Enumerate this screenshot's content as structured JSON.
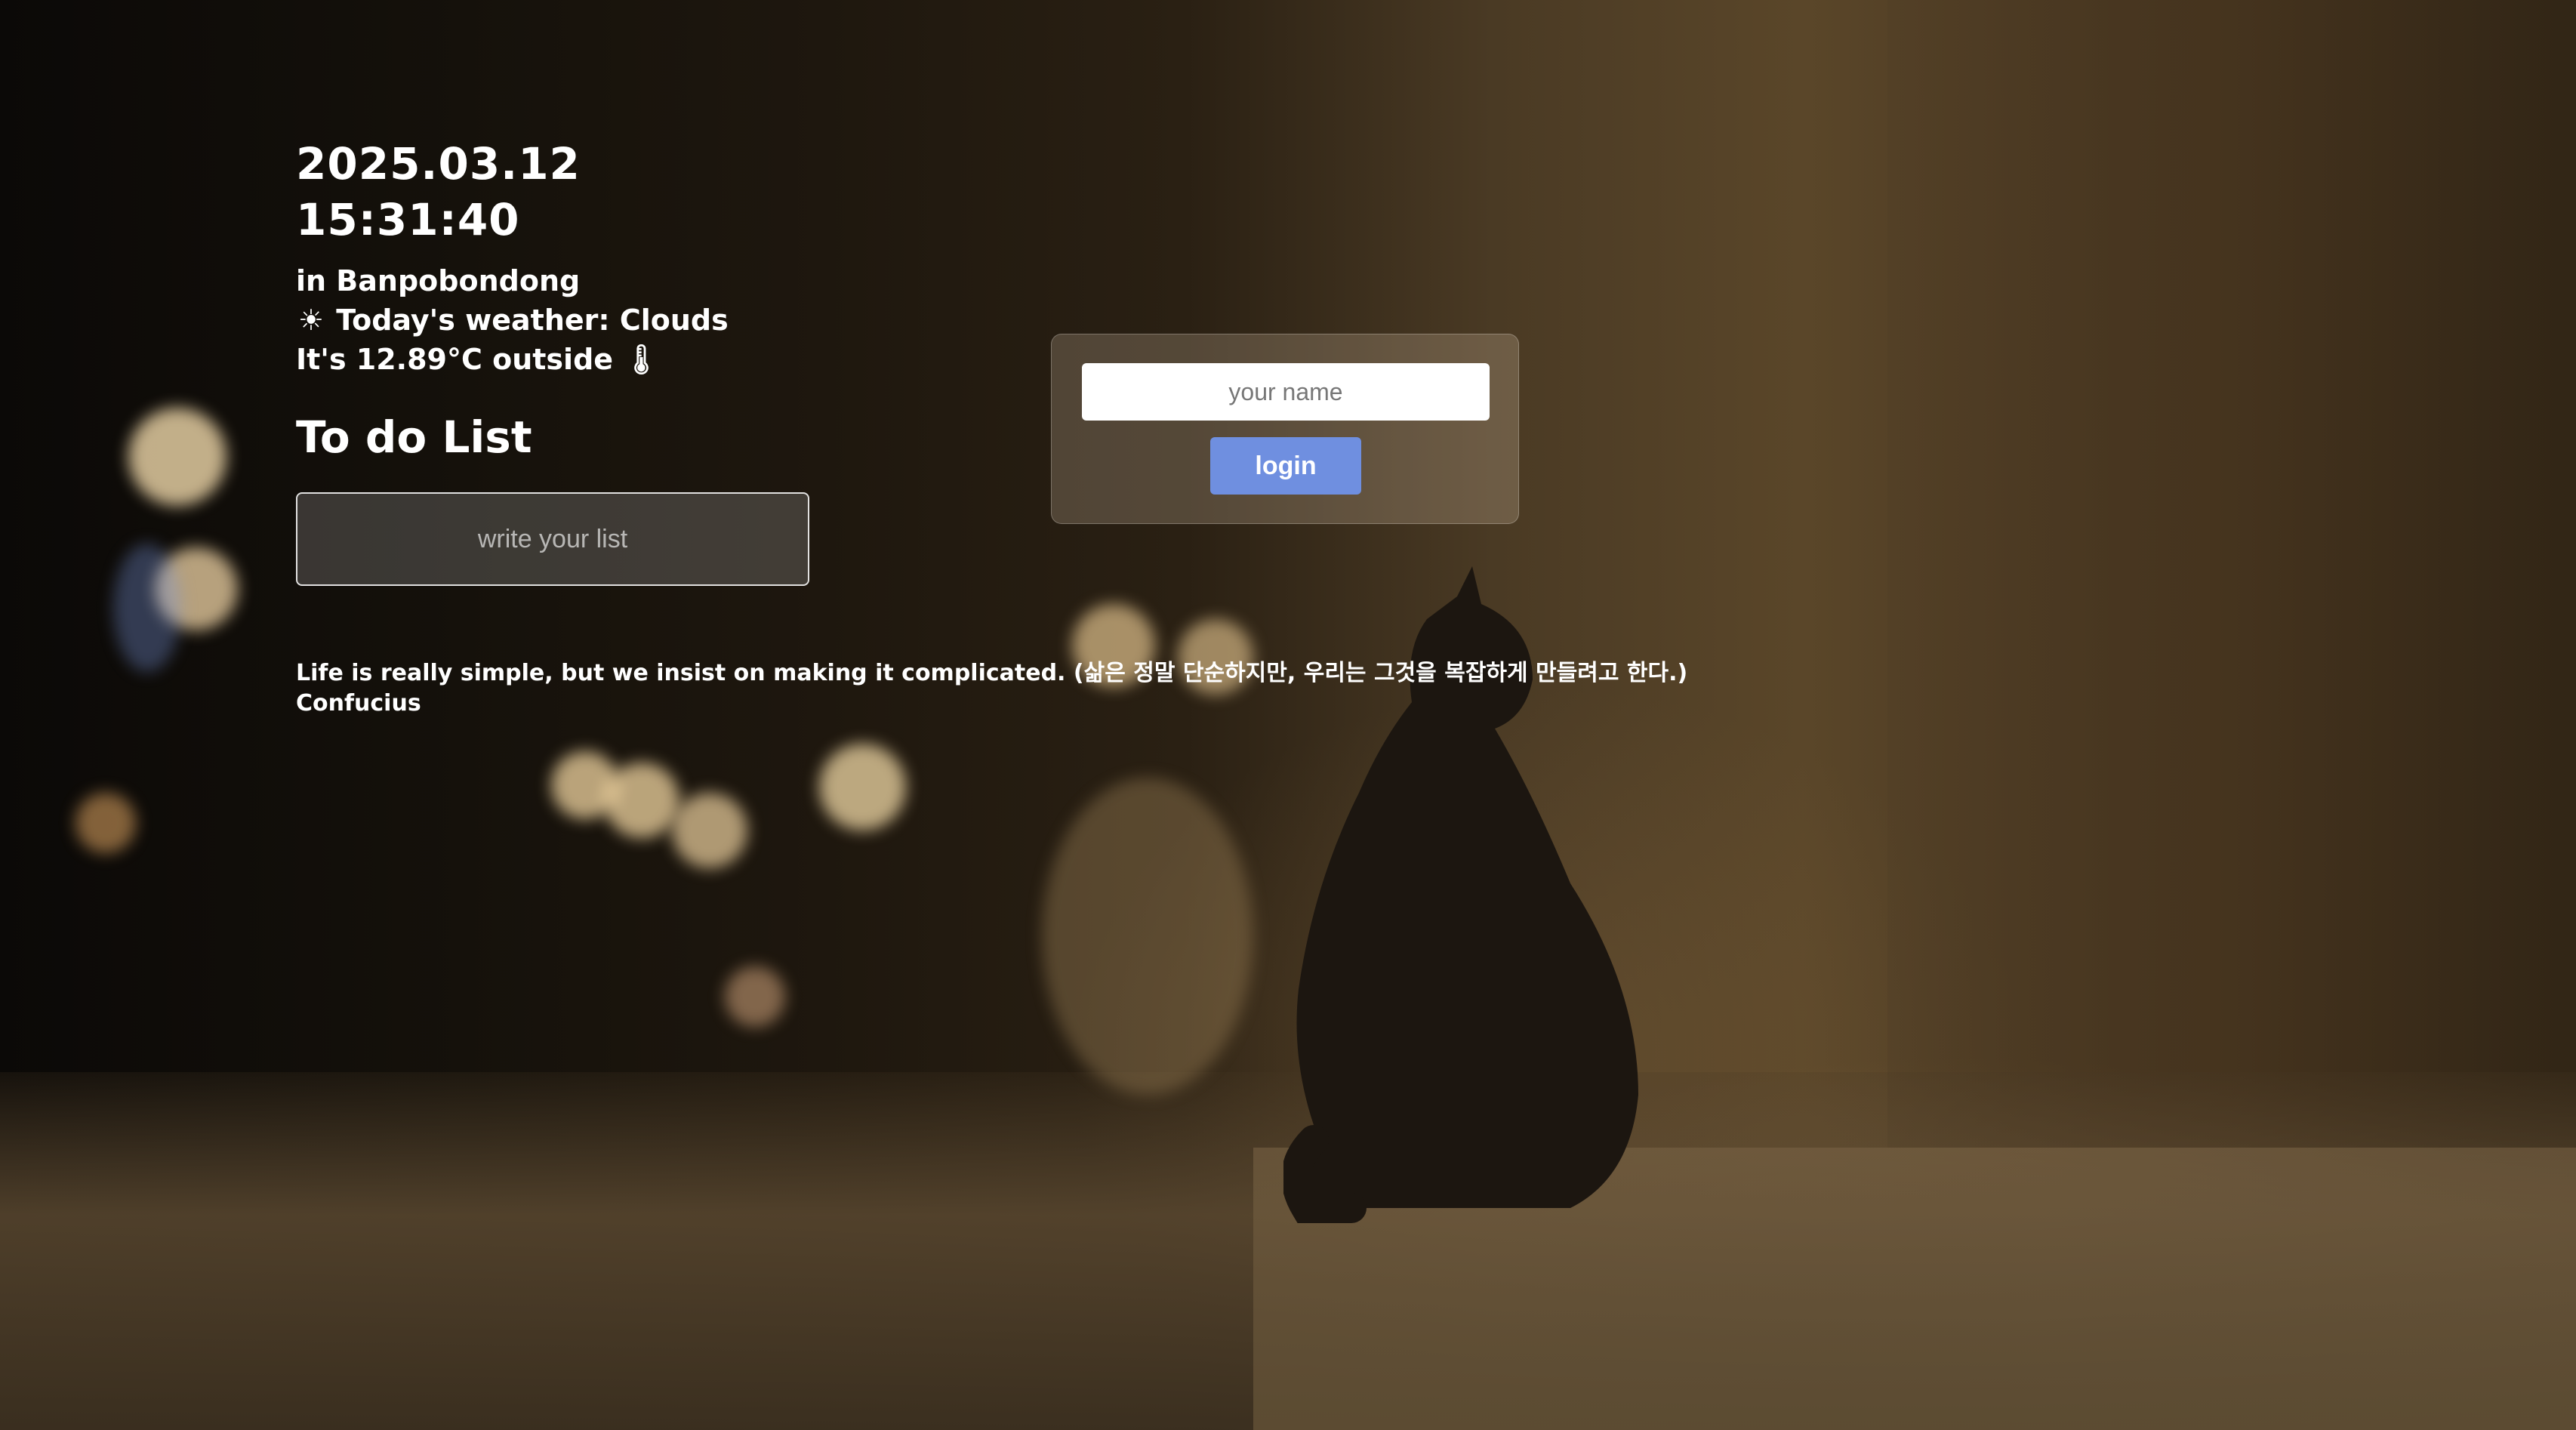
{
  "clock": {
    "date": "2025.03.12",
    "time": "15:31:40"
  },
  "weather": {
    "location_line": "in Banpobondong",
    "weather_icon": "☀",
    "weather_line": "Today's weather: Clouds",
    "temperature_line": "It's 12.89°C outside",
    "thermometer_icon": "🌡"
  },
  "todo": {
    "title": "To do List",
    "input_placeholder": "write your list"
  },
  "quote": {
    "text": "Life is really simple, but we insist on making it complicated. (삶은 정말 단순하지만, 우리는 그것을 복잡하게 만들려고 한다.)",
    "author": "Confucius"
  },
  "login": {
    "input_placeholder": "your name",
    "button_label": "login",
    "button_color": "#6f8fe0"
  }
}
